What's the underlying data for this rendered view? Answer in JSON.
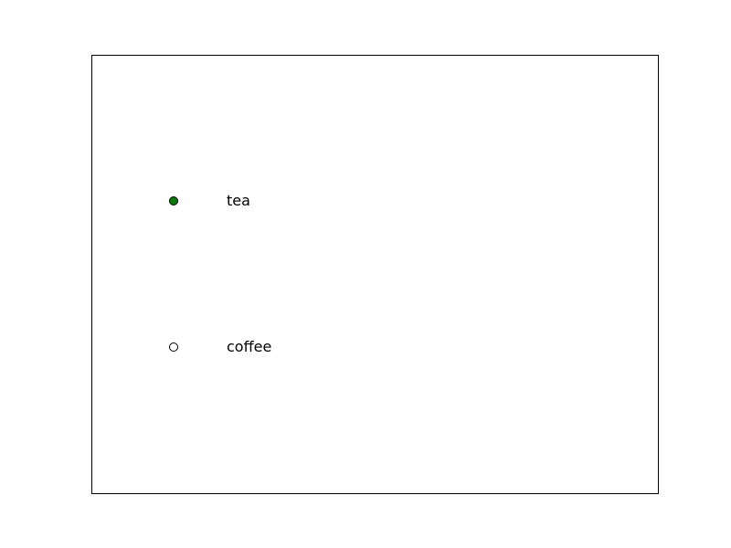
{
  "radio_group": {
    "selected": "tea",
    "active_color": "#0b7a0b",
    "options": [
      {
        "label": "tea",
        "checked": true
      },
      {
        "label": "coffee",
        "checked": false
      }
    ]
  }
}
